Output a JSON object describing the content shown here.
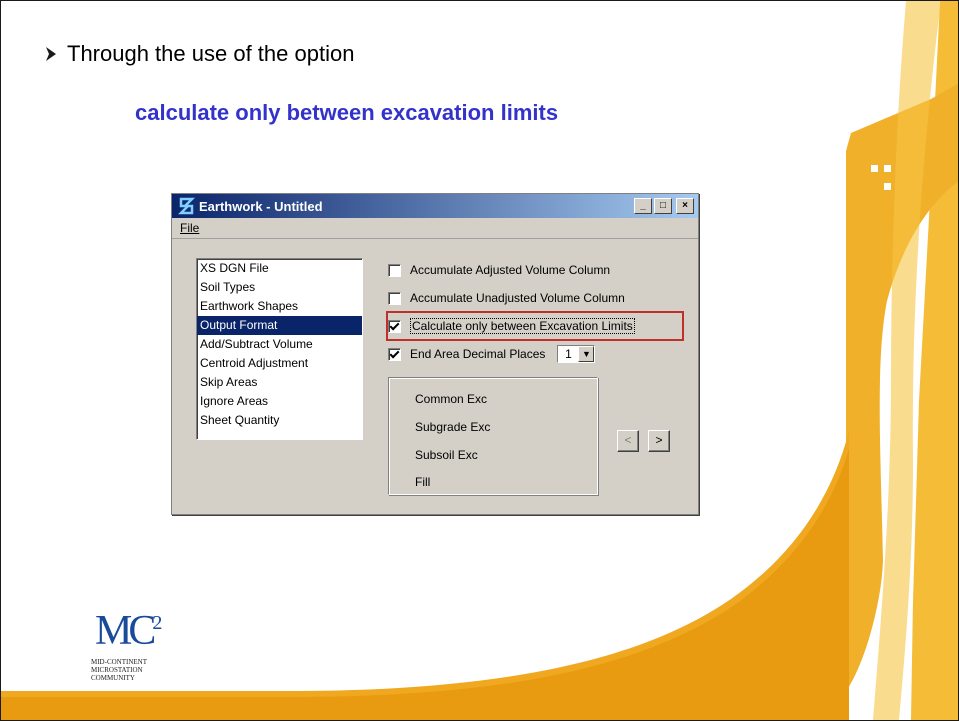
{
  "slide": {
    "bullet_text": "Through the use of the option",
    "subheading": "calculate only between excavation limits"
  },
  "window": {
    "title": "Earthwork - Untitled",
    "menu": [
      "File"
    ],
    "list_items": [
      {
        "label": "XS DGN File",
        "selected": false
      },
      {
        "label": "Soil Types",
        "selected": false
      },
      {
        "label": "Earthwork Shapes",
        "selected": false
      },
      {
        "label": "Output Format",
        "selected": true
      },
      {
        "label": "Add/Subtract Volume",
        "selected": false
      },
      {
        "label": "Centroid Adjustment",
        "selected": false
      },
      {
        "label": "Skip Areas",
        "selected": false
      },
      {
        "label": "Ignore Areas",
        "selected": false
      },
      {
        "label": "Sheet Quantity",
        "selected": false
      }
    ],
    "options": [
      {
        "label": "Accumulate Adjusted Volume Column",
        "checked": false
      },
      {
        "label": "Accumulate Unadjusted Volume Column",
        "checked": false
      },
      {
        "label": "Calculate only between Excavation Limits",
        "checked": true
      },
      {
        "label": "End Area Decimal Places",
        "checked": true
      }
    ],
    "decimal_places": "1",
    "output_columns": [
      "Common Exc",
      "Subgrade Exc",
      "Subsoil Exc",
      "Fill"
    ],
    "nav_prev": "<",
    "nav_next": ">"
  },
  "logo": {
    "mark": "MC²",
    "lines": [
      "Mid-Continent",
      "MicroStation",
      "Community"
    ]
  },
  "colors": {
    "heading_blue": "#3333cc",
    "swoosh_orange": "#f0b02a",
    "highlight_red": "#c0302a",
    "selection": "#0a246a"
  }
}
